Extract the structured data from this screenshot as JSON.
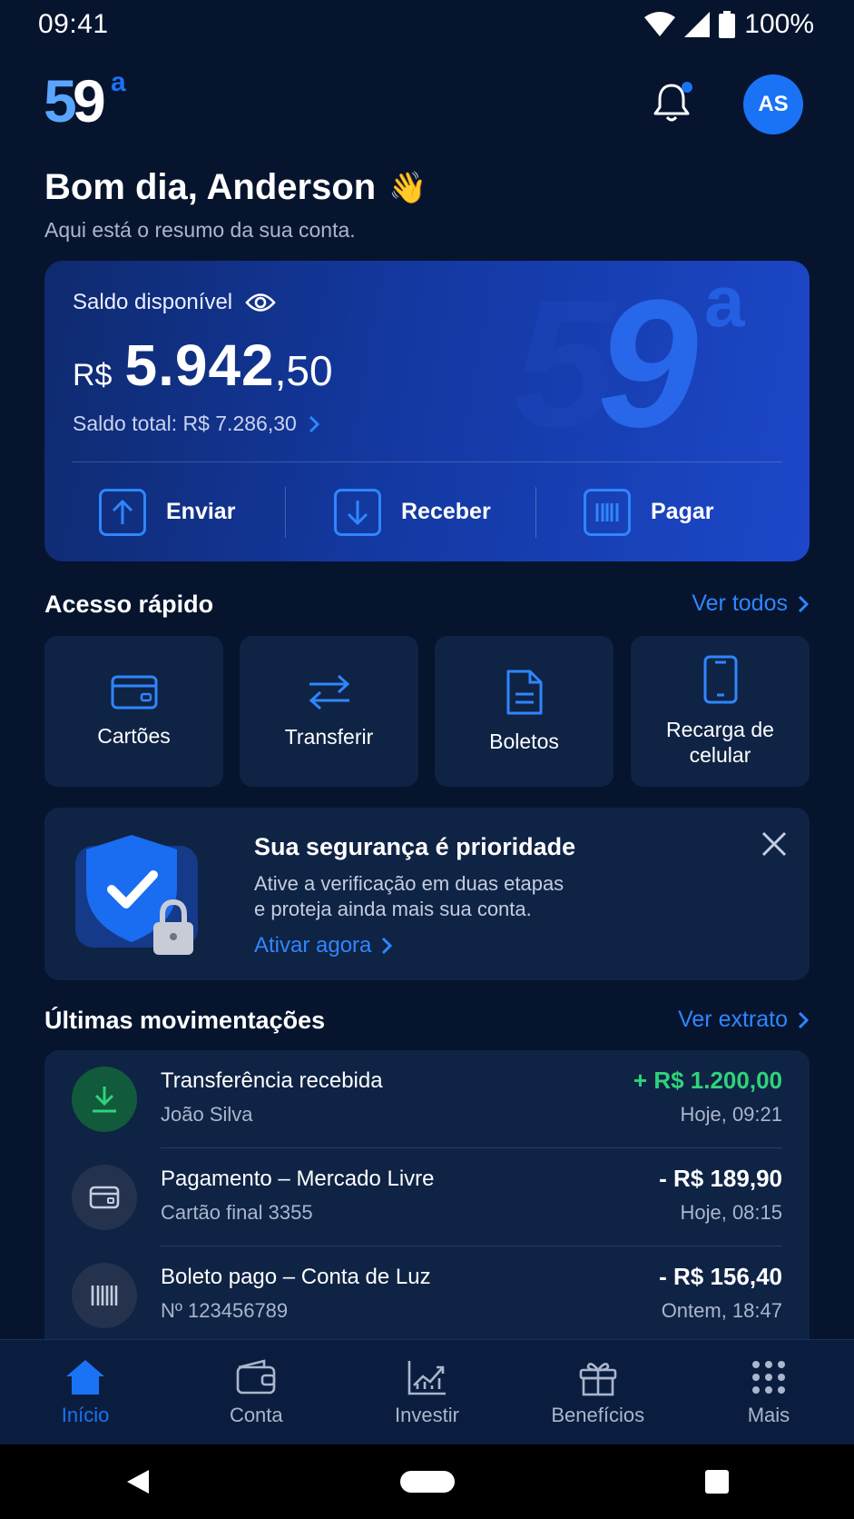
{
  "status_bar": {
    "time": "09:41",
    "battery": "100%"
  },
  "header": {
    "logo_text": "59",
    "logo_sup": "a",
    "avatar_initials": "AS"
  },
  "greeting": {
    "title": "Bom dia, Anderson",
    "emoji": "👋",
    "subtitle": "Aqui está o resumo da sua conta."
  },
  "balance": {
    "label": "Saldo disponível",
    "currency": "R$",
    "amount_int": "5.942",
    "amount_dec": ",50",
    "total": "Saldo total: R$ 7.286,30",
    "actions": [
      {
        "label": "Enviar",
        "icon": "arrow-up-icon"
      },
      {
        "label": "Receber",
        "icon": "arrow-down-icon"
      },
      {
        "label": "Pagar",
        "icon": "barcode-icon"
      }
    ]
  },
  "quick_access": {
    "title": "Acesso rápido",
    "link": "Ver todos",
    "items": [
      {
        "label": "Cartões",
        "icon": "card-icon"
      },
      {
        "label": "Transferir",
        "icon": "transfer-icon"
      },
      {
        "label": "Boletos",
        "icon": "document-icon"
      },
      {
        "label": "Recarga de celular",
        "icon": "phone-icon"
      }
    ]
  },
  "security": {
    "title": "Sua segurança é prioridade",
    "line1": "Ative a verificação em duas etapas",
    "line2": "e proteja ainda mais sua conta.",
    "link": "Ativar agora"
  },
  "transactions": {
    "title": "Últimas movimentações",
    "link": "Ver extrato",
    "items": [
      {
        "title": "Transferência recebida",
        "sub": "João Silva",
        "amount": "+ R$ 1.200,00",
        "time": "Hoje, 09:21",
        "icon": "download-icon",
        "amount_color": "#2fd37a"
      },
      {
        "title": "Pagamento – Mercado Livre",
        "sub": "Cartão final 3355",
        "amount": "- R$ 189,90",
        "time": "Hoje, 08:15",
        "icon": "card-icon",
        "amount_color": "#ffffff"
      },
      {
        "title": "Boleto pago – Conta de Luz",
        "sub": "Nº 123456789",
        "amount": "- R$ 156,40",
        "time": "Ontem, 18:47",
        "icon": "barcode-icon",
        "amount_color": "#ffffff"
      }
    ]
  },
  "bottom_nav": {
    "items": [
      {
        "label": "Início",
        "icon": "home-icon",
        "active": true
      },
      {
        "label": "Conta",
        "icon": "wallet-icon"
      },
      {
        "label": "Investir",
        "icon": "chart-icon"
      },
      {
        "label": "Benefícios",
        "icon": "gift-icon"
      },
      {
        "label": "Mais",
        "icon": "grid-icon"
      }
    ]
  },
  "colors": {
    "accent": "#1a73f5",
    "link": "#2f86ff",
    "background": "#06142e",
    "surface": "#0f2345",
    "positive": "#2fd37a"
  }
}
